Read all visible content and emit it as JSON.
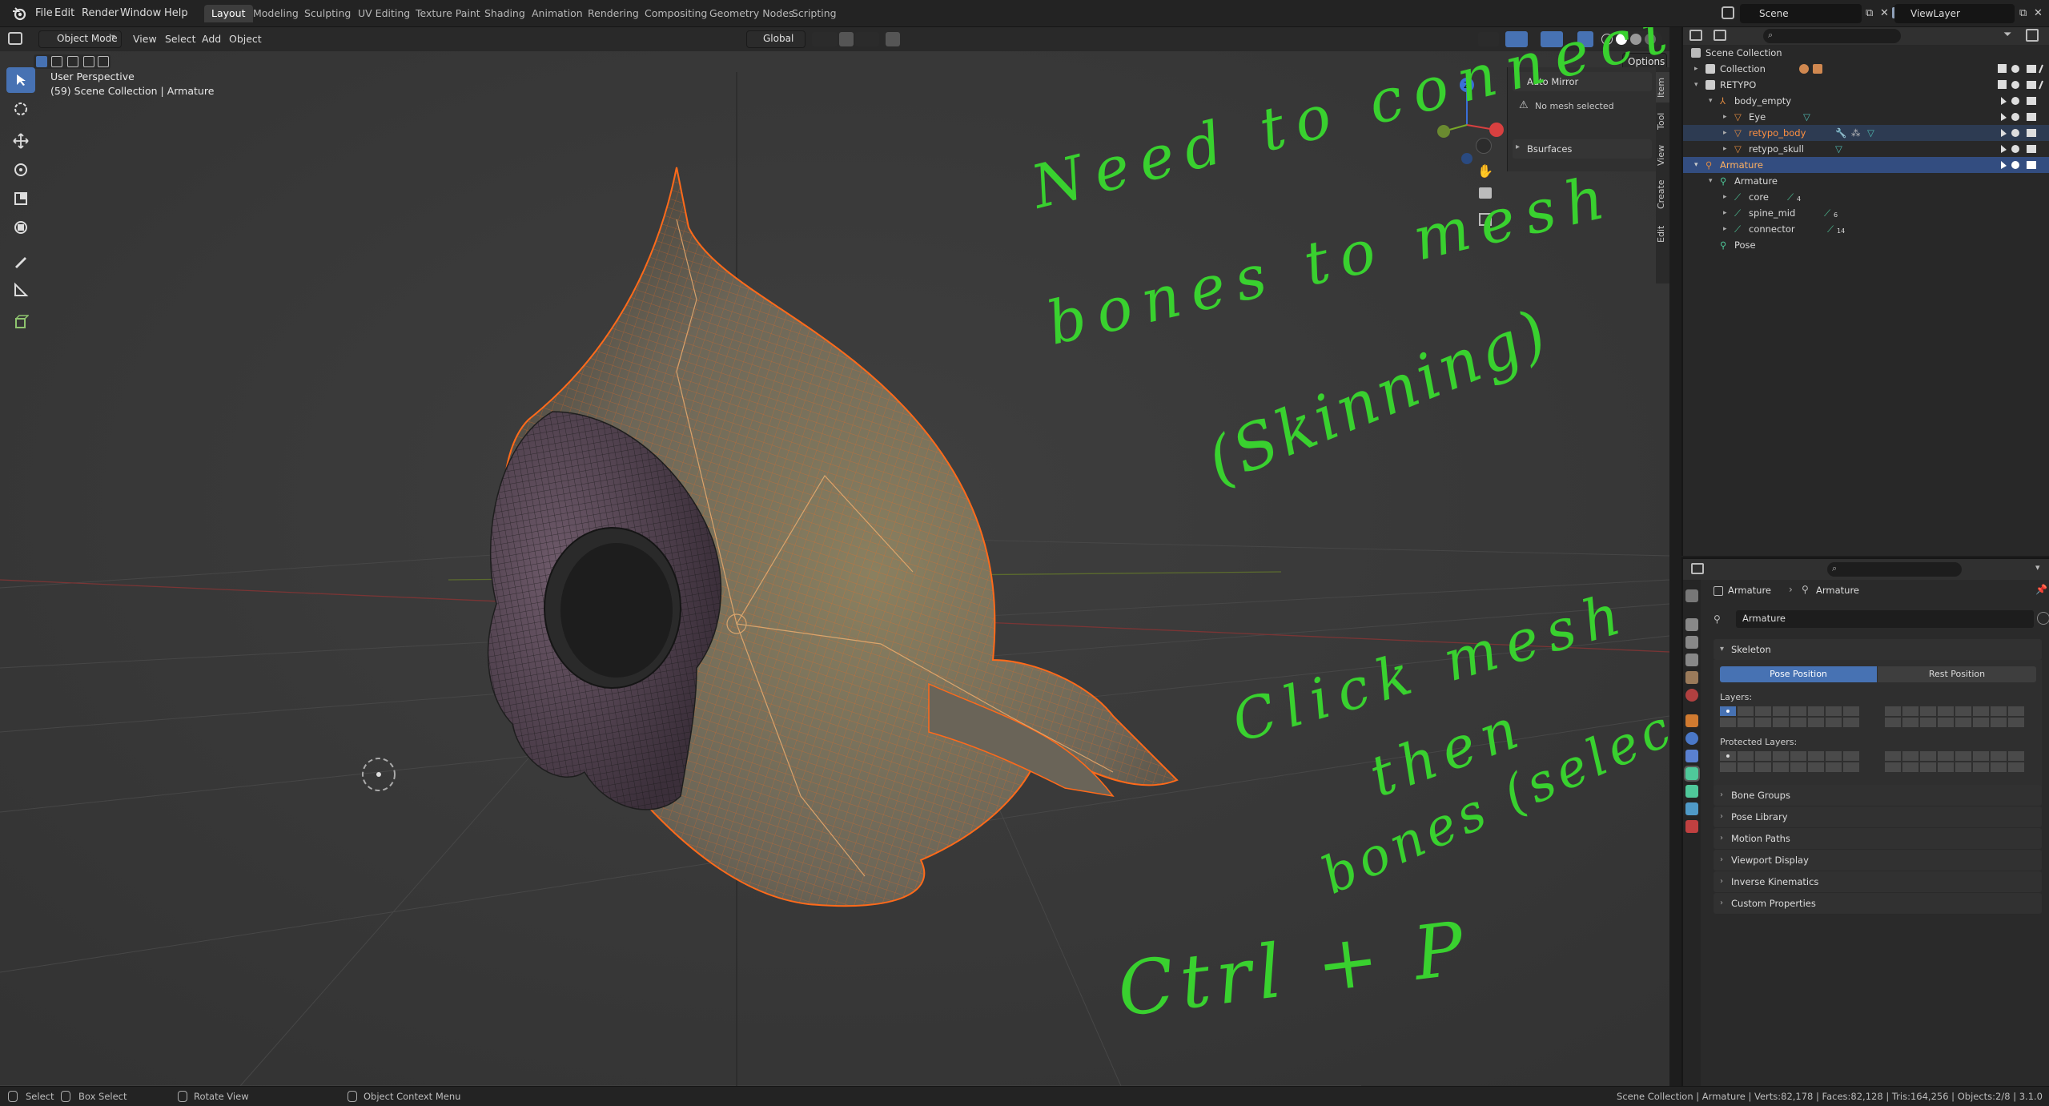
{
  "topbar": {
    "menus": [
      "File",
      "Edit",
      "Render",
      "Window",
      "Help"
    ],
    "workspaces": [
      "Layout",
      "Modeling",
      "Sculpting",
      "UV Editing",
      "Texture Paint",
      "Shading",
      "Animation",
      "Rendering",
      "Compositing",
      "Geometry Nodes",
      "Scripting"
    ],
    "active_workspace": "Layout",
    "scene": "Scene",
    "view_layer": "ViewLayer"
  },
  "viewport": {
    "mode": "Object Mode",
    "menus": [
      "View",
      "Select",
      "Add",
      "Object"
    ],
    "orientation": "Global",
    "options_label": "Options",
    "info_line1": "User Perspective",
    "info_line2": "(59) Scene Collection | Armature",
    "npanel": {
      "auto_mirror": "Auto Mirror",
      "no_mesh": "No mesh selected",
      "bsurfaces": "Bsurfaces",
      "tabs": [
        "Item",
        "Tool",
        "View",
        "Create",
        "Edit"
      ]
    },
    "gizmo": {
      "z": "Z"
    }
  },
  "annotations": {
    "line1": "Need to connect",
    "line2": "bones to mesh",
    "line3": "(Skinning)",
    "line4": "Click mesh",
    "line5": "then",
    "line6": "bones (select)",
    "line7": "Ctrl + P",
    "color": "#39d12f"
  },
  "outliner": {
    "root": "Scene Collection",
    "rows": [
      {
        "label": "Collection"
      },
      {
        "label": "RETYPO"
      },
      {
        "label": "body_empty"
      },
      {
        "label": "Eye"
      },
      {
        "label": "retypo_body"
      },
      {
        "label": "retypo_skull"
      },
      {
        "label": "Armature"
      },
      {
        "label": "Armature"
      },
      {
        "label": "core",
        "badge": "4"
      },
      {
        "label": "spine_mid",
        "badge": "6"
      },
      {
        "label": "connector",
        "badge": "14"
      },
      {
        "label": "Pose"
      }
    ]
  },
  "properties": {
    "breadcrumb_obj": "Armature",
    "breadcrumb_data": "Armature",
    "data_name": "Armature",
    "skeleton": "Skeleton",
    "pose_position": "Pose Position",
    "rest_position": "Rest Position",
    "layers_label": "Layers:",
    "protected_layers_label": "Protected Layers:",
    "panels": [
      "Bone Groups",
      "Pose Library",
      "Motion Paths",
      "Viewport Display",
      "Inverse Kinematics",
      "Custom Properties"
    ]
  },
  "statusbar": {
    "select": "Select",
    "box_select": "Box Select",
    "rotate_view": "Rotate View",
    "context_menu": "Object Context Menu",
    "stats": "Scene Collection | Armature | Verts:82,178 | Faces:82,128 | Tris:164,256 | Objects:2/8 | 3.1.0"
  },
  "colors": {
    "accent": "#4772b3",
    "selected_orange": "#ff7a2e",
    "annotation_green": "#39d12f"
  }
}
